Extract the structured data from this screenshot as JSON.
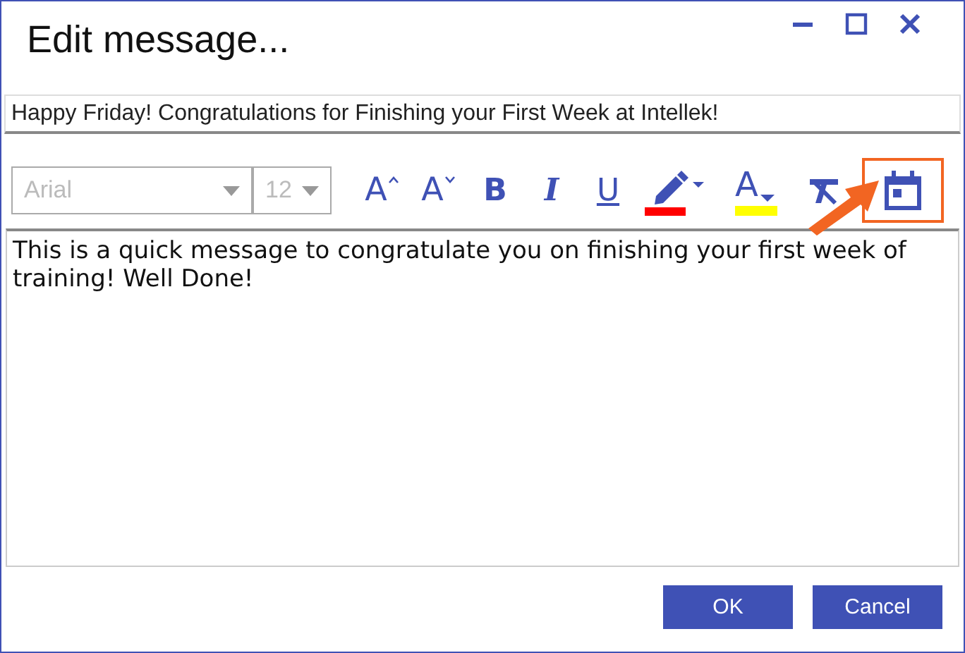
{
  "window": {
    "title": "Edit message..."
  },
  "subject": {
    "value": "Happy Friday! Congratulations for Finishing your First Week at Intellek!"
  },
  "toolbar": {
    "font": {
      "value": "Arial",
      "disabled": true
    },
    "size": {
      "value": "12",
      "disabled": true
    },
    "tools": [
      {
        "kind": "grow",
        "glyph": "A"
      },
      {
        "kind": "shrink",
        "glyph": "A"
      },
      {
        "kind": "bold",
        "glyph": "B"
      },
      {
        "kind": "italic",
        "glyph": "I"
      },
      {
        "kind": "underline",
        "glyph": "U"
      },
      {
        "kind": "highlight",
        "color": "#ff0000"
      },
      {
        "kind": "fontcolor",
        "glyph": "A",
        "color": "#ffff00"
      },
      {
        "kind": "clear"
      },
      {
        "kind": "calendar",
        "highlighted": true
      }
    ]
  },
  "body": {
    "value": "This is a quick message to congratulate you on finishing your first week of training! Well Done!"
  },
  "buttons": [
    "OK",
    "Cancel"
  ]
}
